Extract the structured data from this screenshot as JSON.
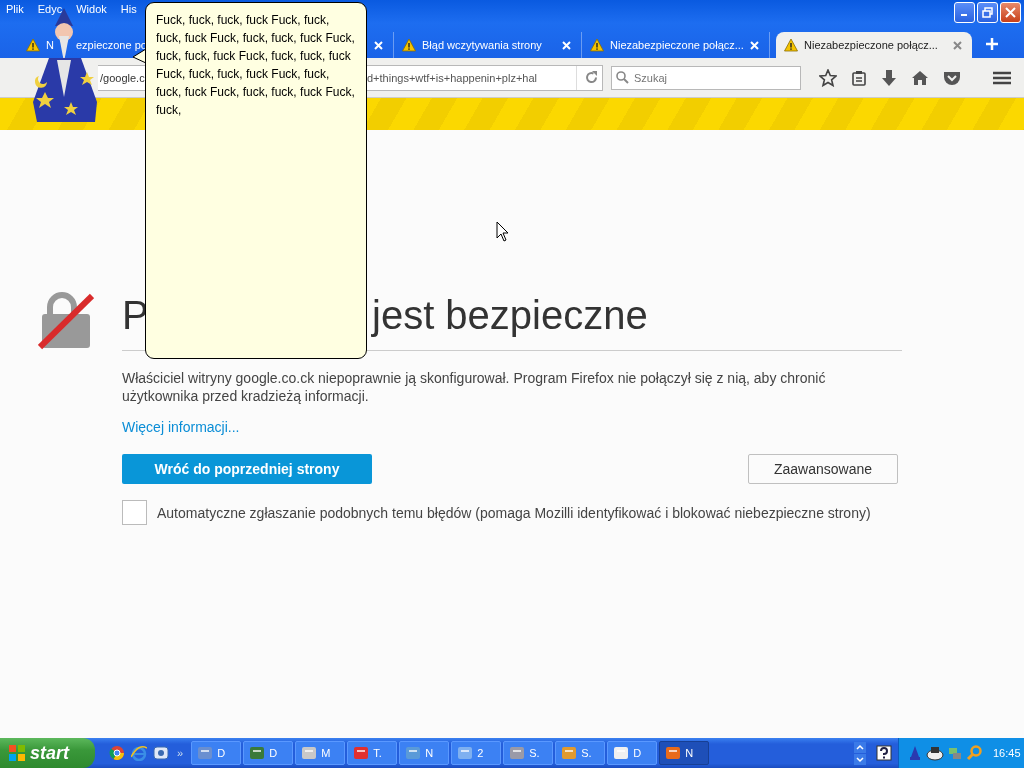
{
  "menu": [
    {
      "label": "Plik"
    },
    {
      "label": "Edyc"
    },
    {
      "label": "Widok"
    },
    {
      "label": "His"
    }
  ],
  "tabs": [
    {
      "title_parts": [
        "N",
        "ezpieczone po"
      ],
      "warning": true,
      "selected": false
    },
    {
      "selected": false
    },
    {
      "title": "Błąd wczytywania strony",
      "warning": true,
      "selected": false
    },
    {
      "title": "Niezabezpieczone połącz...",
      "warning": true,
      "selected": false
    },
    {
      "title": "Niezabezpieczone połącz...",
      "warning": true,
      "selected": true
    }
  ],
  "address": {
    "parts": [
      "/google.c",
      "d+things+wtf+is+happenin+plz+hal"
    ]
  },
  "search": {
    "placeholder": "Szukaj"
  },
  "balloon": {
    "text": "Fuck, fuck, fuck, fuck Fuck, fuck, fuck, fuck Fuck, fuck, fuck, fuck Fuck, fuck, fuck, fuck Fuck, fuck, fuck, fuck Fuck, fuck, fuck, fuck Fuck, fuck, fuck, fuck Fuck, fuck, fuck, fuck Fuck, fuck,"
  },
  "page": {
    "heading_parts": [
      "P",
      "jest bezpieczne"
    ],
    "description": "Właściciel witryny google.co.ck niepoprawnie ją skonfigurował. Program Firefox nie połączył się z nią, aby chronić użytkownika przed kradzieżą informacji.",
    "more_link": "Więcej informacji...",
    "back_button": "Wróć do poprzedniej strony",
    "advanced_button": "Zaawansowane",
    "report": {
      "checked": false,
      "label": "Automatyczne zgłaszanie podobnych temu błędów (pomaga Mozilli identyfikować i blokować niebezpieczne strony)"
    }
  },
  "taskbar": {
    "start": "start",
    "more": "»",
    "tasks": [
      {
        "label": "D",
        "selected": false
      },
      {
        "label": "D",
        "selected": false
      },
      {
        "label": "M",
        "selected": false
      },
      {
        "label": "T.",
        "selected": false
      },
      {
        "label": "N",
        "selected": false
      },
      {
        "label": "2",
        "selected": false
      },
      {
        "label": "S.",
        "selected": false
      },
      {
        "label": "S.",
        "selected": false
      },
      {
        "label": "D",
        "selected": false
      },
      {
        "label": "N",
        "selected": true
      }
    ],
    "clock": "16:45"
  }
}
